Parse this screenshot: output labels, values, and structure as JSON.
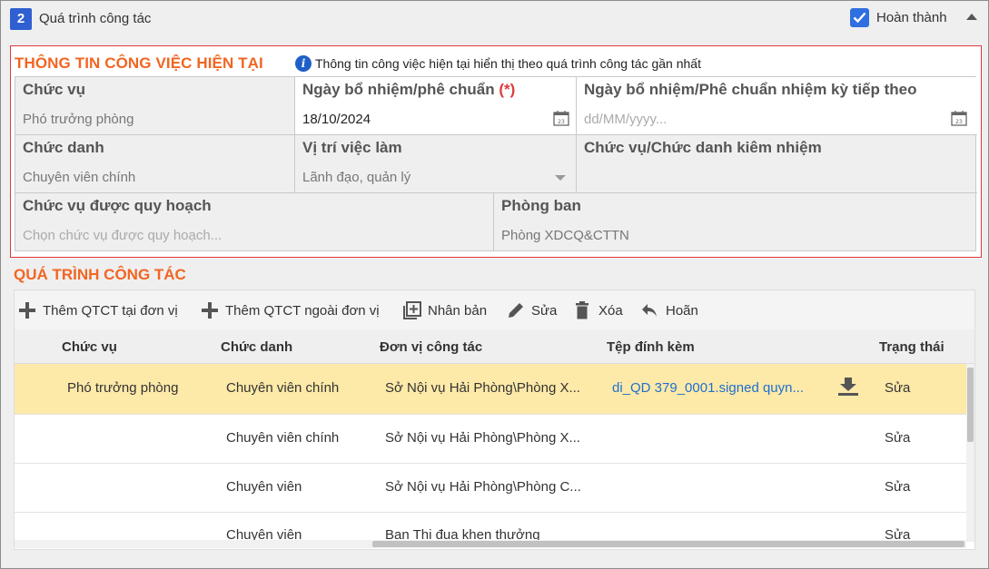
{
  "section": {
    "number": "2",
    "title": "Quá trình công tác",
    "done_label": "Hoàn thành",
    "done_checked": true
  },
  "current_info": {
    "title": "THÔNG TIN CÔNG VIỆC HIỆN TẠI",
    "note": "Thông tin công việc hiện tại hiển thị theo quá trình công tác gần nhất",
    "fields": {
      "position": {
        "label": "Chức vụ",
        "value": "Phó trưởng phòng"
      },
      "appoint_date": {
        "label": "Ngày bổ nhiệm/phê chuẩn",
        "required_mark": "(*)",
        "value": "18/10/2024"
      },
      "next_term_date": {
        "label": "Ngày bổ nhiệm/Phê chuẩn nhiệm kỳ tiếp theo",
        "placeholder": "dd/MM/yyyy..."
      },
      "title": {
        "label": "Chức danh",
        "value": "Chuyên viên chính"
      },
      "job_position": {
        "label": "Vị trí việc làm",
        "value": "Lãnh đạo, quản lý"
      },
      "concurrent": {
        "label": "Chức vụ/Chức danh kiêm nhiệm",
        "value": ""
      },
      "planned_position": {
        "label": "Chức vụ được quy hoạch",
        "placeholder": "Chọn chức vụ được quy hoạch..."
      },
      "department": {
        "label": "Phòng ban",
        "value": "Phòng XDCQ&CTTN"
      }
    }
  },
  "process": {
    "title": "QUÁ TRÌNH CÔNG TÁC",
    "toolbar": {
      "add_internal": "Thêm QTCT tại đơn vị",
      "add_external": "Thêm QTCT ngoài đơn vị",
      "duplicate": "Nhân bản",
      "edit": "Sửa",
      "delete": "Xóa",
      "undo": "Hoãn"
    },
    "columns": [
      "Chức vụ",
      "Chức danh",
      "Đơn vị công tác",
      "Tệp đính kèm",
      "Trạng thái"
    ],
    "rows": [
      {
        "position": "Phó trưởng phòng",
        "title": "Chuyên viên chính",
        "unit": "Sở Nội vụ Hải Phòng\\Phòng X...",
        "attachment": "di_QD 379_0001.signed quyn...",
        "status": "Sửa",
        "selected": true
      },
      {
        "position": "",
        "title": "Chuyên viên chính",
        "unit": "Sở Nội vụ Hải Phòng\\Phòng X...",
        "attachment": "",
        "status": "Sửa",
        "selected": false
      },
      {
        "position": "",
        "title": "Chuyên viên",
        "unit": "Sở Nội vụ Hải Phòng\\Phòng C...",
        "attachment": "",
        "status": "Sửa",
        "selected": false
      },
      {
        "position": "",
        "title": "Chuyên viên",
        "unit": "Ban Thi đua khen thưởng",
        "attachment": "",
        "status": "Sửa",
        "selected": false
      }
    ]
  },
  "colors": {
    "accent_orange": "#f26522",
    "required_red": "#e03a3a",
    "primary_blue": "#2f6fe0",
    "selected_row": "#fde9a8",
    "link_blue": "#1f6fd0"
  }
}
